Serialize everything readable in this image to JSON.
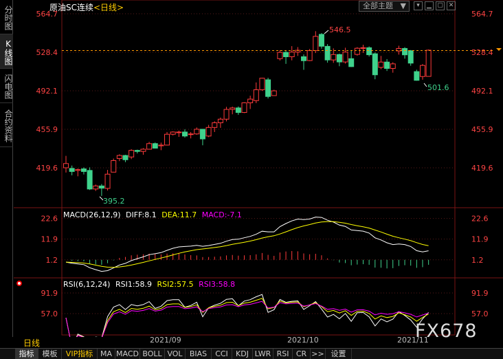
{
  "left_tabs": [
    "分时图",
    "K线图",
    "闪电图",
    "合约资料"
  ],
  "active_left_tab": "K线图",
  "header": {
    "title": "原油SC连续",
    "period_link": "<日线>",
    "theme_button": "全部主题",
    "theme_arrow": "▼"
  },
  "price_axis": {
    "left": [
      "564.7",
      "528.4",
      "492.1",
      "455.9",
      "419.6"
    ],
    "right": [
      "564.7",
      "528.4",
      "492.1",
      "455.9",
      "419.6"
    ]
  },
  "annotations": {
    "high": "546.5",
    "low": "395.2",
    "recent_low": "501.6"
  },
  "macd": {
    "label": "MACD(26,12,9)",
    "diff": "DIFF:8.1",
    "dea": "DEA:11.7",
    "macd": "MACD:-7.1",
    "axis": [
      "22.6",
      "11.9",
      "1.2"
    ]
  },
  "rsi": {
    "label": "RSI(6,12,24)",
    "rsi1": "RSI1:58.9",
    "rsi2": "RSI2:57.5",
    "rsi3": "RSI3:58.8",
    "axis": [
      "91.9",
      "57.0"
    ]
  },
  "x_axis": [
    "2021/09",
    "2021/10",
    "2021/11"
  ],
  "period_label": "日线",
  "watermark": "FX678",
  "bottom_tabs": [
    "指标",
    "模板",
    "VIP指标",
    "MA",
    "MACD",
    "BOLL",
    "VOL",
    "BIAS",
    "CCI",
    "KDJ",
    "LWR",
    "RSI",
    "CR",
    ">>",
    "设置"
  ],
  "colors": {
    "up": "#ff3b3b",
    "down": "#3fd28c",
    "diff_line": "#ffffff",
    "dea_line": "#ffff00",
    "rsi3_line": "#ff00ff",
    "grid": "#5a1a1a",
    "last_price": "#ff9900"
  },
  "candles": [
    [
      419.6,
      423.6,
      415.1,
      430.8
    ],
    [
      419.0,
      416.1,
      412.5,
      421.7
    ],
    [
      417.1,
      417.9,
      411.6,
      419.0
    ],
    [
      418.6,
      416.1,
      413.3,
      420.0
    ],
    [
      417.1,
      399.6,
      398.7,
      420.0
    ],
    [
      399.6,
      402.5,
      397.8,
      403.8
    ],
    [
      402.5,
      400.4,
      393.1,
      404.3
    ],
    [
      400.2,
      413.6,
      398.2,
      417.6
    ],
    [
      415.5,
      426.4,
      415.5,
      428.3
    ],
    [
      428.3,
      431.2,
      425.9,
      432.3
    ],
    [
      431.2,
      427.2,
      424.9,
      431.8
    ],
    [
      429.8,
      436.0,
      427.8,
      437.1
    ],
    [
      436.0,
      435.0,
      433.1,
      436.7
    ],
    [
      435.0,
      437.1,
      431.9,
      438.1
    ],
    [
      437.1,
      442.4,
      436.7,
      444.0
    ],
    [
      442.4,
      438.1,
      437.8,
      443.4
    ],
    [
      440.3,
      441.0,
      436.2,
      443.3
    ],
    [
      441.0,
      451.2,
      440.6,
      453.3
    ],
    [
      451.2,
      453.3,
      450.1,
      454.0
    ],
    [
      453.3,
      453.3,
      448.7,
      454.6
    ],
    [
      453.3,
      449.5,
      448.1,
      455.9
    ],
    [
      451.0,
      451.5,
      447.3,
      453.3
    ],
    [
      451.5,
      455.9,
      450.7,
      457.6
    ],
    [
      455.9,
      446.8,
      440.8,
      456.0
    ],
    [
      449.5,
      457.6,
      448.5,
      460.0
    ],
    [
      457.6,
      462.0,
      453.3,
      463.4
    ],
    [
      462.0,
      465.4,
      457.2,
      466.9
    ],
    [
      465.4,
      474.6,
      463.3,
      477.0
    ],
    [
      474.6,
      476.0,
      470.0,
      477.2
    ],
    [
      476.0,
      471.7,
      469.5,
      477.4
    ],
    [
      471.7,
      480.8,
      471.2,
      481.3
    ],
    [
      480.8,
      484.3,
      475.0,
      487.5
    ],
    [
      482.9,
      493.1,
      480.5,
      500.0
    ],
    [
      493.1,
      504.0,
      492.1,
      504.4
    ],
    [
      502.5,
      486.8,
      484.9,
      504.4
    ],
    [
      487.6,
      492.1,
      487.6,
      493.1
    ],
    [
      522.4,
      528.3,
      520.7,
      530.4
    ],
    [
      528.3,
      524.2,
      517.5,
      530.4
    ],
    [
      524.2,
      528.6,
      520.8,
      534.2
    ],
    [
      528.6,
      530.3,
      525.0,
      533.3
    ],
    [
      524.2,
      520.5,
      511.9,
      526.4
    ],
    [
      520.6,
      530.0,
      520.1,
      531.5
    ],
    [
      530.0,
      543.4,
      527.7,
      548.3
    ],
    [
      545.3,
      534.1,
      531.8,
      546.5
    ],
    [
      534.0,
      521.2,
      518.6,
      536.1
    ],
    [
      521.2,
      526.3,
      518.5,
      532.1
    ],
    [
      526.3,
      519.3,
      515.3,
      527.1
    ],
    [
      519.3,
      528.6,
      517.8,
      532.7
    ],
    [
      522.4,
      514.9,
      514.5,
      530.2
    ],
    [
      526.4,
      532.2,
      525.3,
      533.2
    ],
    [
      532.2,
      532.7,
      527.8,
      535.5
    ],
    [
      532.7,
      526.1,
      524.4,
      533.9
    ],
    [
      527.0,
      507.2,
      503.0,
      528.2
    ],
    [
      514.2,
      519.2,
      512.5,
      525.0
    ],
    [
      519.2,
      513.2,
      510.8,
      522.0
    ],
    [
      513.2,
      517.5,
      509.2,
      519.0
    ],
    [
      529.7,
      532.0,
      526.2,
      534.6
    ],
    [
      532.0,
      526.0,
      522.4,
      533.2
    ],
    [
      529.9,
      518.2,
      515.7,
      530.5
    ],
    [
      510.2,
      502.0,
      501.6,
      512.0
    ],
    [
      505.6,
      516.0,
      502.6,
      517.3
    ],
    [
      505.7,
      530.4,
      505.7,
      531.0
    ]
  ]
}
